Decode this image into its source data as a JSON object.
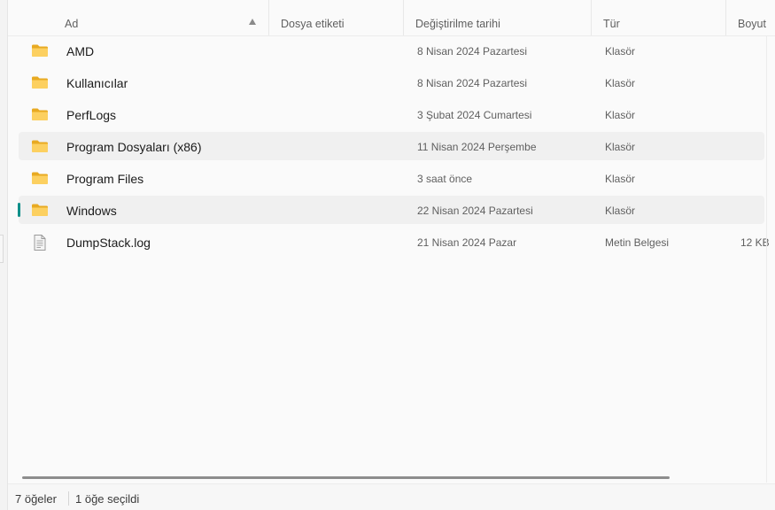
{
  "columns": {
    "name": "Ad",
    "tag": "Dosya etiketi",
    "modified": "Değiştirilme tarihi",
    "type": "Tür",
    "size": "Boyut"
  },
  "rows": [
    {
      "name": "AMD",
      "modified": "8 Nisan 2024 Pazartesi",
      "type": "Klasör",
      "size": "",
      "icon": "folder-icon"
    },
    {
      "name": "Kullanıcılar",
      "modified": "8 Nisan 2024 Pazartesi",
      "type": "Klasör",
      "size": "",
      "icon": "folder-icon"
    },
    {
      "name": "PerfLogs",
      "modified": "3 Şubat 2024 Cumartesi",
      "type": "Klasör",
      "size": "",
      "icon": "folder-icon"
    },
    {
      "name": "Program Dosyaları (x86)",
      "modified": "11 Nisan 2024 Perşembe",
      "type": "Klasör",
      "size": "",
      "icon": "folder-icon"
    },
    {
      "name": "Program Files",
      "modified": "3 saat önce",
      "type": "Klasör",
      "size": "",
      "icon": "folder-icon"
    },
    {
      "name": "Windows",
      "modified": "22 Nisan 2024 Pazartesi",
      "type": "Klasör",
      "size": "",
      "icon": "folder-icon"
    },
    {
      "name": "DumpStack.log",
      "modified": "21 Nisan 2024 Pazar",
      "type": "Metin Belgesi",
      "size": "12 KB",
      "icon": "text-file-icon"
    }
  ],
  "status": {
    "item_count": "7 öğeler",
    "selected": "1 öğe seçildi"
  },
  "colors": {
    "folder": "#f8c94a",
    "selection_accent": "#0f8f8a"
  }
}
